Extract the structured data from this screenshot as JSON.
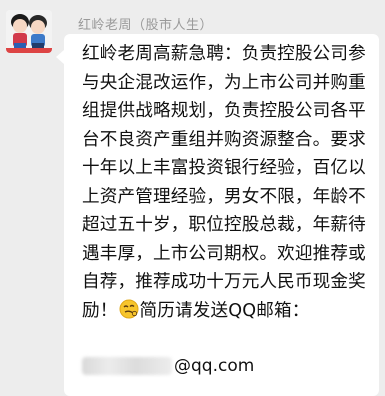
{
  "sender": {
    "name": "红岭老周（股市人生）"
  },
  "message": {
    "part1": "红岭老周高薪急聘：负责控股公司参与央企混改运作，为上市公司并购重组提供战略规划，负责控股公司各平台不良资产重组并购资源整合。要求十年以上丰富投资银行经验，百亿以上资产管理经验，男女不限，年龄不超过五十岁，职位控股总裁，年薪待遇丰厚，上市公司期权。欢迎推荐或自荐，推荐成功十万元人民币现金奖励！",
    "part2": "简历请发送QQ邮箱：",
    "emoji": "face-emoji",
    "email_domain": "@qq.com"
  }
}
